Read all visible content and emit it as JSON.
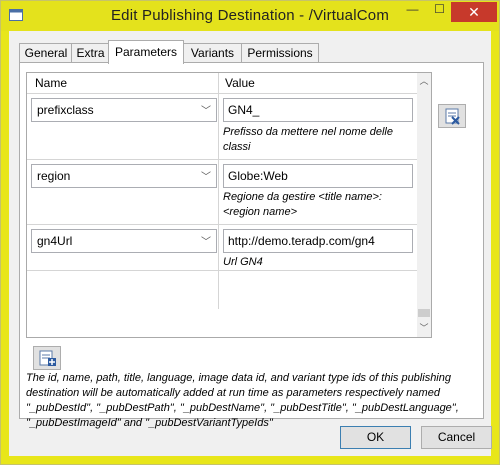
{
  "window": {
    "title": "Edit Publishing Destination - /VirtualCom"
  },
  "titlebar_buttons": {
    "minimize": "—",
    "maximize": "☐",
    "close": "✕"
  },
  "tabs": [
    {
      "label": "General"
    },
    {
      "label": "Extra"
    },
    {
      "label": "Parameters",
      "active": true
    },
    {
      "label": "Variants"
    },
    {
      "label": "Permissions"
    }
  ],
  "grid": {
    "headers": {
      "name": "Name",
      "value": "Value"
    },
    "rows": [
      {
        "name": "prefixclass",
        "value": "GN4_",
        "description": "Prefisso da mettere nel nome delle classi"
      },
      {
        "name": "region",
        "value": "Globe:Web",
        "description": "Regione da gestire <title name>:<region name>"
      },
      {
        "name": "gn4Url",
        "value": "http://demo.teradp.com/gn4",
        "description": "Url GN4"
      }
    ]
  },
  "info_text": "The id, name, path, title, language, image data id, and variant type ids of this publishing destination will be automatically added at run time as parameters respectively named \"_pubDestId\", \"_pubDestPath\", \"_pubDestName\", \"_pubDestTitle\", \"_pubDestLanguage\", \"_pubDestImageId\" and \"_pubDestVariantTypeIds\"",
  "buttons": {
    "ok": "OK",
    "cancel": "Cancel"
  },
  "colors": {
    "titlebar": "#e4e21c",
    "close": "#c7392b"
  }
}
